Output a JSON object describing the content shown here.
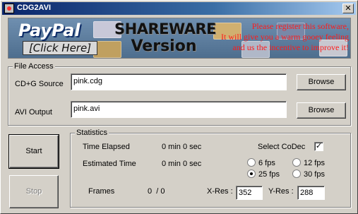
{
  "window": {
    "title": "CDG2AVI",
    "close_glyph": "✕"
  },
  "banner": {
    "paypal_logo": "PayPal",
    "paypal_click": "[Click Here]",
    "shareware_line1": "SHAREWARE",
    "shareware_line2": "Version",
    "register_line1": "Please register this software,",
    "register_line2": "It will give you a warm gooey feeling",
    "register_line3": "and us the incentive to improve it!",
    "colors": {
      "message": "#ff1a1a",
      "background": "#5d7d9e"
    }
  },
  "file_access": {
    "legend": "File Access",
    "cdg_label": "CD+G Source",
    "cdg_value": "pink.cdg",
    "avi_label": "AVI Output",
    "avi_value": "pink.avi",
    "browse_label": "Browse"
  },
  "actions": {
    "start_label": "Start",
    "stop_label": "Stop"
  },
  "statistics": {
    "legend": "Statistics",
    "time_elapsed_label": "Time Elapsed",
    "time_elapsed_value": "0 min 0 sec",
    "estimated_label": "Estimated Time",
    "estimated_value": "0 min 0 sec",
    "frames_label": "Frames",
    "frames_value": "0  / 0",
    "codec_label": "Select CoDec",
    "codec_checked": true,
    "check_glyph": "✓",
    "fps_options": [
      {
        "label": "6 fps",
        "checked": false
      },
      {
        "label": "12 fps",
        "checked": false
      },
      {
        "label": "25 fps",
        "checked": true
      },
      {
        "label": "30 fps",
        "checked": false
      }
    ],
    "xres_label": "X-Res :",
    "xres_value": "352",
    "yres_label": "Y-Res :",
    "yres_value": "288"
  }
}
